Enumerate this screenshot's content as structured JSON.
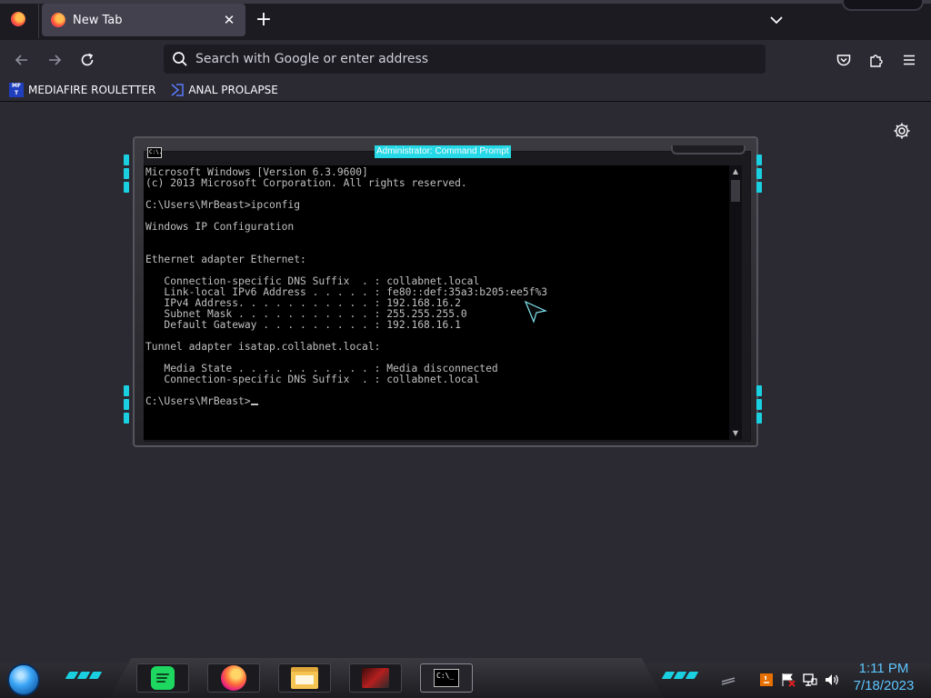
{
  "browser": {
    "tab": {
      "title": "New Tab",
      "close": "✕"
    },
    "new_tab": "+",
    "url_placeholder": "Search with Google or enter address",
    "bookmarks": [
      {
        "icon": "mft-icon",
        "icon_text": "MF T",
        "label": "MEDIAFIRE ROULETTER"
      },
      {
        "icon": "anal-prolapse-icon",
        "label": "ANAL PROLAPSE"
      }
    ],
    "accent_color": "#1ad0e0"
  },
  "cmd": {
    "title": "Administrator: Command Prompt",
    "icon_text": "C:\\.",
    "lines": [
      "Microsoft Windows [Version 6.3.9600]",
      "(c) 2013 Microsoft Corporation. All rights reserved.",
      "",
      "C:\\Users\\MrBeast>ipconfig",
      "",
      "Windows IP Configuration",
      "",
      "",
      "Ethernet adapter Ethernet:",
      "",
      "   Connection-specific DNS Suffix  . : collabnet.local",
      "   Link-local IPv6 Address . . . . . : fe80::def:35a3:b205:ee5f%3",
      "   IPv4 Address. . . . . . . . . . . : 192.168.16.2",
      "   Subnet Mask . . . . . . . . . . . : 255.255.255.0",
      "   Default Gateway . . . . . . . . . : 192.168.16.1",
      "",
      "Tunnel adapter isatap.collabnet.local:",
      "",
      "   Media State . . . . . . . . . . . : Media disconnected",
      "   Connection-specific DNS Suffix  . : collabnet.local",
      ""
    ],
    "prompt": "C:\\Users\\MrBeast>"
  },
  "taskbar": {
    "cmd_icon_text": "C:\\_",
    "clock": {
      "time": "1:11 PM",
      "date": "7/18/2023"
    }
  }
}
